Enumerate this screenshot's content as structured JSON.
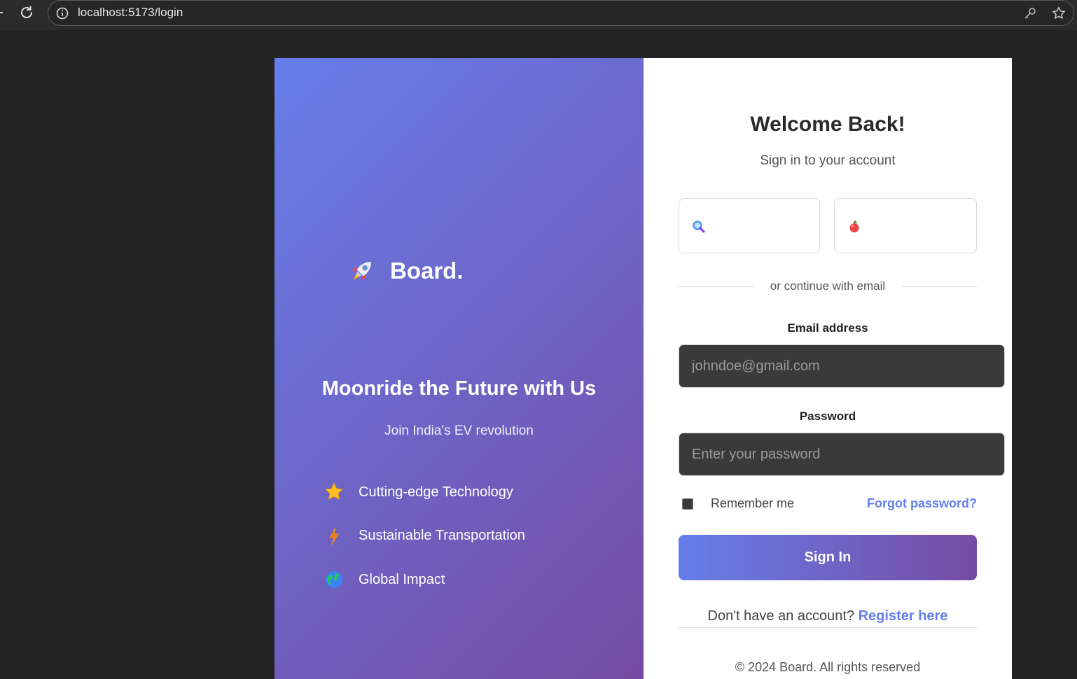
{
  "browser": {
    "url": "localhost:5173/login"
  },
  "left_panel": {
    "brand_name": "Board.",
    "hero_title": "Moonride the Future with Us",
    "hero_subtitle": "Join India's EV revolution",
    "features": [
      {
        "icon": "star-icon",
        "label": "Cutting-edge Technology"
      },
      {
        "icon": "lightning-icon",
        "label": "Sustainable Transportation"
      },
      {
        "icon": "globe-icon",
        "label": "Global Impact"
      }
    ]
  },
  "login": {
    "title": "Welcome Back!",
    "subtitle": "Sign in to your account",
    "social_buttons": [
      {
        "icon": "magnifier-icon",
        "label": ""
      },
      {
        "icon": "apple-icon",
        "label": ""
      }
    ],
    "divider_text": "or continue with email",
    "email_label": "Email address",
    "email_placeholder": "johndoe@gmail.com",
    "password_label": "Password",
    "password_placeholder": "Enter your password",
    "remember_label": "Remember me",
    "remember_checked": false,
    "forgot_label": "Forgot password?",
    "submit_label": "Sign In",
    "register_prompt": "Don't have an account?",
    "register_link": "Register here",
    "footer": "© 2024 Board. All rights reserved"
  },
  "colors": {
    "gradient_start": "#667eea",
    "gradient_end": "#764ba2",
    "link": "#667eea"
  }
}
